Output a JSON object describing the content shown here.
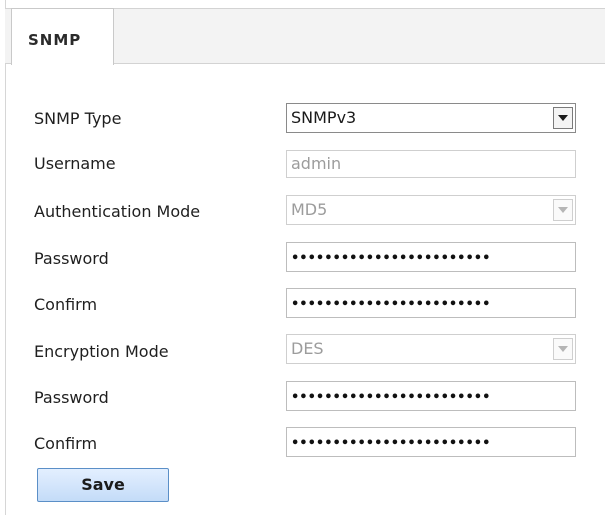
{
  "tab": {
    "label": "SNMP"
  },
  "form": {
    "snmp_type": {
      "label": "SNMP Type",
      "value": "SNMPv3"
    },
    "username": {
      "label": "Username",
      "value": "admin"
    },
    "auth_mode": {
      "label": "Authentication Mode",
      "value": "MD5"
    },
    "auth_password": {
      "label": "Password",
      "value": "••••••••••••••••••••••••"
    },
    "auth_confirm": {
      "label": "Confirm",
      "value": "••••••••••••••••••••••••"
    },
    "encryption_mode": {
      "label": "Encryption Mode",
      "value": "DES"
    },
    "enc_password": {
      "label": "Password",
      "value": "••••••••••••••••••••••••"
    },
    "enc_confirm": {
      "label": "Confirm",
      "value": "••••••••••••••••••••••••"
    }
  },
  "actions": {
    "save_label": "Save"
  },
  "icons": {
    "dropdown": "chevron-down-icon"
  },
  "colors": {
    "button_border": "#5b8fc7",
    "button_fill": "#c4dcf8",
    "disabled_text": "#9c9c9c"
  }
}
